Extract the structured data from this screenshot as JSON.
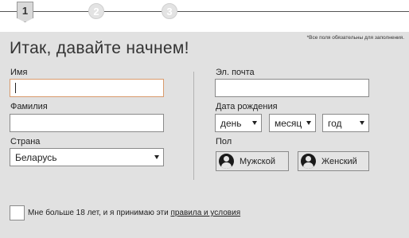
{
  "steps": {
    "current": "1",
    "step2": "2",
    "step3": "3"
  },
  "form": {
    "title": "Итак, давайте начнем!",
    "required_note": "*Все поля обязательны для заполнения.",
    "first_name": {
      "label": "Имя",
      "value": ""
    },
    "last_name": {
      "label": "Фамилия",
      "value": ""
    },
    "country": {
      "label": "Страна",
      "value": "Беларусь"
    },
    "email": {
      "label": "Эл. почта",
      "value": ""
    },
    "birthdate": {
      "label": "Дата рождения",
      "day": "день",
      "month": "месяц",
      "year": "год"
    },
    "gender": {
      "label": "Пол",
      "male": "Мужской",
      "female": "Женский"
    },
    "agreement": {
      "text": "Мне больше 18 лет, и я принимаю эти",
      "link": "правила и условия"
    }
  }
}
